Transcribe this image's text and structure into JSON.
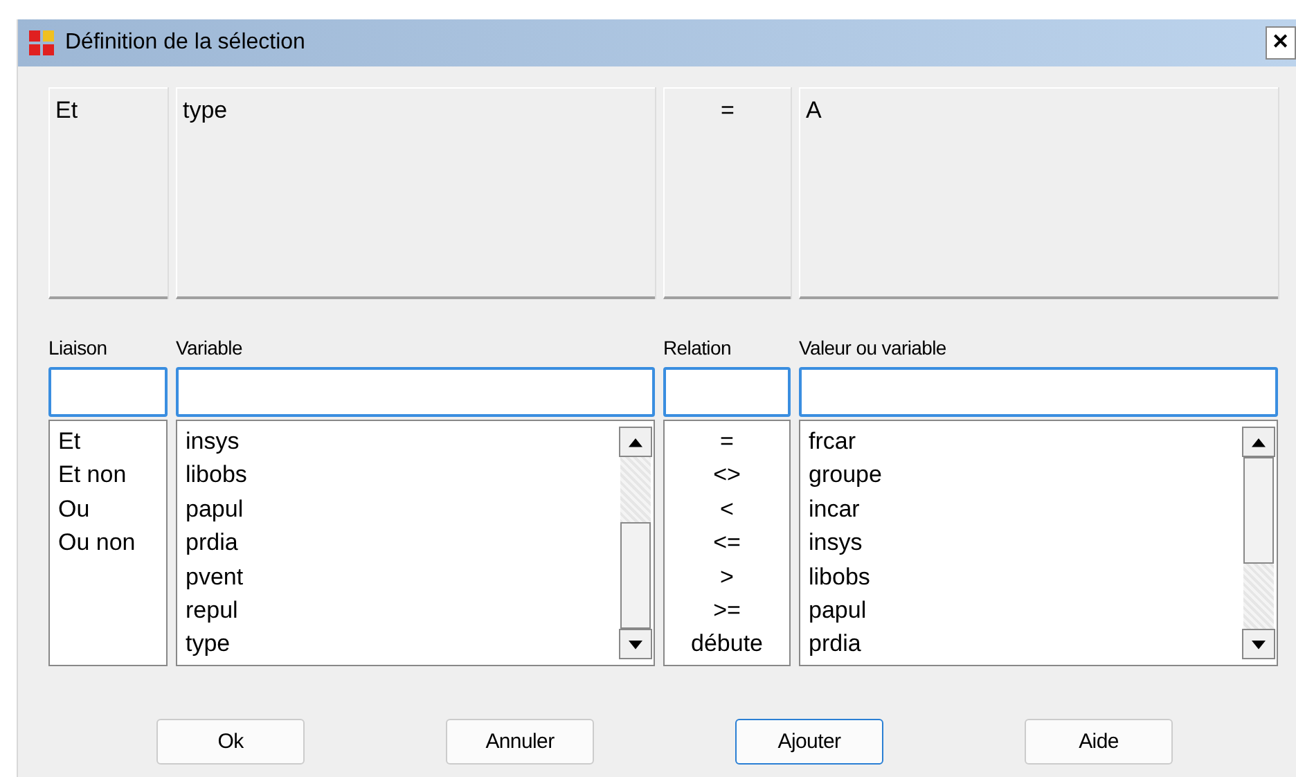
{
  "window": {
    "title": "Définition de la sélection",
    "close": "✕"
  },
  "criteria": [
    {
      "text": "Et"
    },
    {
      "text": "type"
    },
    {
      "text": "="
    },
    {
      "text": "A"
    }
  ],
  "columns": [
    {
      "label": "Liaison",
      "items": [
        "Et",
        "Et non",
        "Ou",
        "Ou non"
      ],
      "kind": "plain"
    },
    {
      "label": "Variable",
      "items": [
        "insys",
        "libobs",
        "papul",
        "prdia",
        "pvent",
        "repul",
        "type"
      ],
      "kind": "scrolled"
    },
    {
      "label": "Relation",
      "items": [
        "=",
        "<>",
        "<",
        "<=",
        ">",
        ">=",
        "débute"
      ],
      "kind": "centered"
    },
    {
      "label": "Valeur ou variable",
      "items": [
        "frcar",
        "groupe",
        "incar",
        "insys",
        "libobs",
        "papul",
        "prdia"
      ],
      "kind": "scrolled"
    }
  ],
  "buttons": [
    {
      "label": "Ok",
      "focused": false
    },
    {
      "label": "Annuler",
      "focused": false
    },
    {
      "label": "Ajouter",
      "focused": true
    },
    {
      "label": "Aide",
      "focused": false
    }
  ]
}
